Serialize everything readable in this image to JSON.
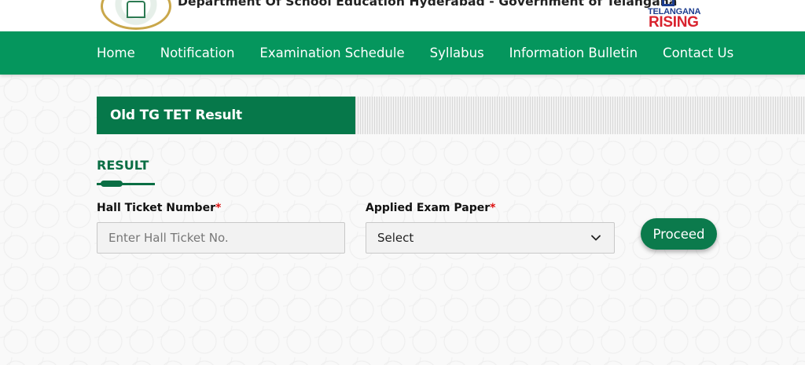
{
  "header": {
    "department_title": "Department Of School Education Hyderabad - Government of Telangana",
    "logo_text_top": "TELANGANA",
    "logo_text_bottom": "RISING"
  },
  "nav": {
    "items": [
      "Home",
      "Notification",
      "Examination Schedule",
      "Syllabus",
      "Information Bulletin",
      "Contact Us"
    ]
  },
  "section": {
    "title": "Old TG TET Result"
  },
  "form": {
    "heading": "RESULT",
    "hall_ticket_label": "Hall Ticket Number",
    "required_mark": "*",
    "hall_ticket_placeholder": "Enter Hall Ticket No.",
    "exam_paper_label": "Applied Exam Paper",
    "exam_paper_selected": "Select",
    "proceed_label": "Proceed"
  },
  "colors": {
    "nav_green": "#05965d",
    "section_green": "#06784a",
    "button_green": "#0b7a4c",
    "required_red": "#d11111",
    "logo_blue": "#1d3d8f",
    "logo_red": "#d9232e"
  }
}
